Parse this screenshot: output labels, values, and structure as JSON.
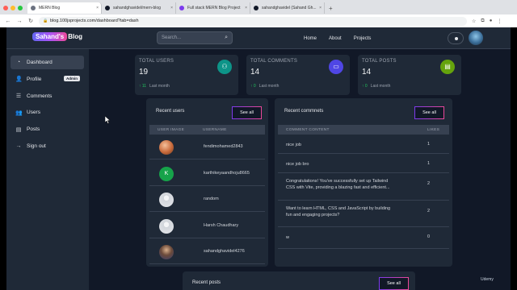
{
  "browser": {
    "tabs": [
      {
        "title": "MERN Blog",
        "fav_color": "#6b7280",
        "active": true
      },
      {
        "title": "sahandghavidel/mern-blog",
        "fav_color": "#111827",
        "active": false
      },
      {
        "title": "Full stack MERN Blog Project",
        "fav_color": "#7c3aed",
        "active": false
      },
      {
        "title": "sahandghavidel (Sahand Gh...",
        "fav_color": "#111827",
        "active": false
      }
    ],
    "url": "blog.100jsprojects.com/dashboard?tab=dash"
  },
  "header": {
    "logo_pill": "Sahand's",
    "logo_rest": "Blog",
    "search_placeholder": "Search...",
    "nav": [
      "Home",
      "About",
      "Projects"
    ]
  },
  "sidebar": {
    "items": [
      {
        "label": "Dashboard",
        "icon": "chart-icon",
        "glyph": "◔",
        "active": true
      },
      {
        "label": "Profile",
        "icon": "user-icon",
        "glyph": "👤",
        "badge": "Admin"
      },
      {
        "label": "Comments",
        "icon": "comments-icon",
        "glyph": "☰"
      },
      {
        "label": "Users",
        "icon": "users-icon",
        "glyph": "👥"
      },
      {
        "label": "Posts",
        "icon": "document-icon",
        "glyph": "▤"
      },
      {
        "label": "Sign out",
        "icon": "arrow-right-icon",
        "glyph": "→"
      }
    ]
  },
  "stats": [
    {
      "title": "TOTAL USERS",
      "value": "19",
      "change": "↑ 11",
      "period": "Last month",
      "color": "#0d9488",
      "glyph": "⚇"
    },
    {
      "title": "TOTAL COMMENTS",
      "value": "14",
      "change": "↑ 0",
      "period": "Last month",
      "color": "#4f46e5",
      "glyph": "▭"
    },
    {
      "title": "TOTAL POSTS",
      "value": "14",
      "change": "↑ 0",
      "period": "Last month",
      "color": "#65a30d",
      "glyph": "▤"
    }
  ],
  "recent_users": {
    "title": "Recent users",
    "see_all": "See all",
    "columns": [
      "USER IMAGE",
      "USERNAME"
    ],
    "rows": [
      {
        "username": "fendimohamed2843",
        "avatar": "photo-orange"
      },
      {
        "username": "karthikeyaandhoju8665",
        "avatar": "letter-k",
        "letter": "K"
      },
      {
        "username": "random",
        "avatar": "default"
      },
      {
        "username": "Harsh Chaudhary",
        "avatar": "default"
      },
      {
        "username": "sahandghavidel4276",
        "avatar": "photo-person"
      }
    ]
  },
  "recent_comments": {
    "title": "Recent commnets",
    "see_all": "See all",
    "columns": [
      "COMMENT CONTENT",
      "LIKES"
    ],
    "rows": [
      {
        "line1": "nice job",
        "line2": "",
        "likes": "1"
      },
      {
        "line1": "nice job bro",
        "line2": "",
        "likes": "1"
      },
      {
        "line1": "Congratulations! You've successfully set up Tailwind",
        "line2": "CSS with Vite, providing a blazing fast and efficient...",
        "likes": "2"
      },
      {
        "line1": "Want to learn HTML, CSS and JavaScript by building",
        "line2": "fun and engaging projects?",
        "likes": "2"
      },
      {
        "line1": "w",
        "line2": "",
        "likes": "0"
      }
    ]
  },
  "recent_posts": {
    "title": "Recent posts",
    "see_all": "See all"
  },
  "watermark": "Udemy"
}
